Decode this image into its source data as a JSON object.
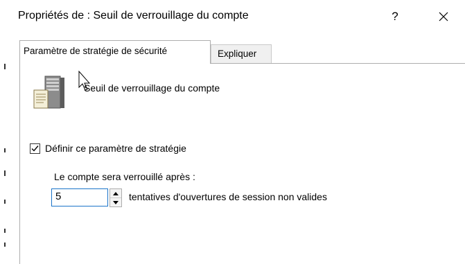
{
  "window": {
    "title": "Propriétés de : Seuil de verrouillage du compte",
    "help_label": "?",
    "close_icon": "close-icon"
  },
  "tabs": [
    {
      "label": "Paramètre de stratégie de sécurité",
      "active": true
    },
    {
      "label": "Expliquer",
      "active": false
    }
  ],
  "policy": {
    "icon": "server-policy-icon",
    "name": "Seuil de verrouillage du compte"
  },
  "define_policy": {
    "label": "Définir ce paramètre de stratégie",
    "checked": true
  },
  "lockout": {
    "label": "Le compte sera verrouillé après :",
    "value": "5",
    "suffix": "tentatives d'ouvertures de session non valides"
  }
}
